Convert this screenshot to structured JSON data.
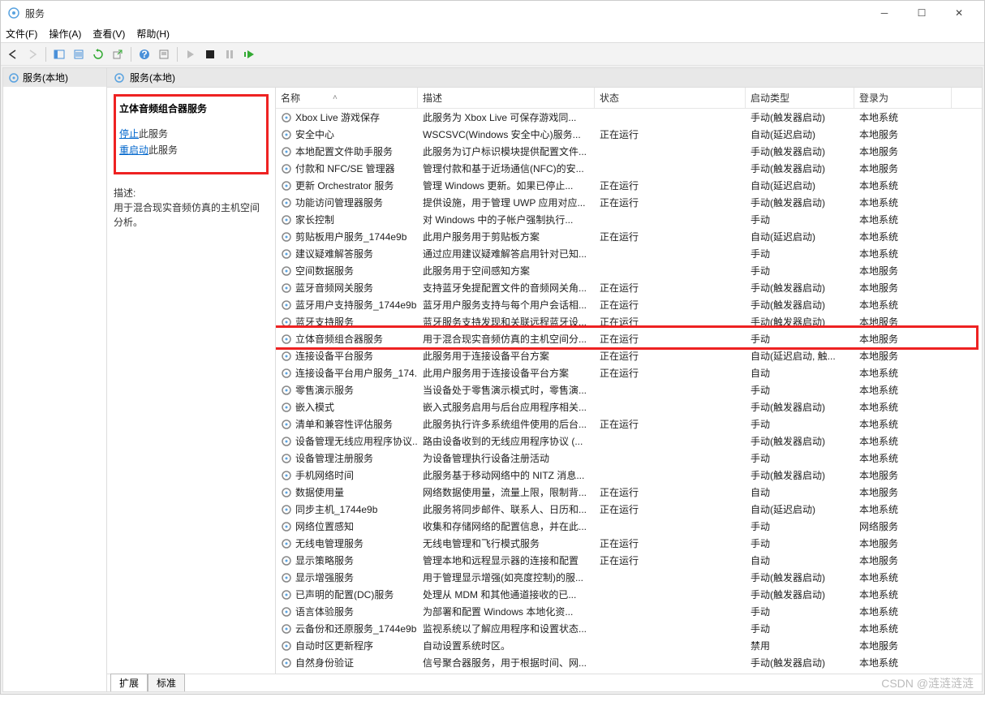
{
  "window": {
    "title": "服务"
  },
  "menu": {
    "file": "文件(F)",
    "action": "操作(A)",
    "view": "查看(V)",
    "help": "帮助(H)"
  },
  "left_tree": {
    "root": "服务(本地)"
  },
  "right_header": {
    "title": "服务(本地)"
  },
  "detail": {
    "service_name": "立体音频组合器服务",
    "stop_link": "停止",
    "stop_suffix": "此服务",
    "restart_link": "重启动",
    "restart_suffix": "此服务",
    "desc_label": "描述:",
    "desc_text": "用于混合现实音频仿真的主机空间分析。"
  },
  "columns": {
    "name": "名称",
    "desc": "描述",
    "status": "状态",
    "start": "启动类型",
    "logon": "登录为"
  },
  "tabs": {
    "ext": "扩展",
    "std": "标准"
  },
  "watermark": "CSDN @涟涟涟涟",
  "services": [
    {
      "name": "Xbox Live 游戏保存",
      "desc": "此服务为 Xbox Live 可保存游戏同...",
      "status": "",
      "start": "手动(触发器启动)",
      "logon": "本地系统"
    },
    {
      "name": "安全中心",
      "desc": "WSCSVC(Windows 安全中心)服务...",
      "status": "正在运行",
      "start": "自动(延迟启动)",
      "logon": "本地服务"
    },
    {
      "name": "本地配置文件助手服务",
      "desc": "此服务为订户标识模块提供配置文件...",
      "status": "",
      "start": "手动(触发器启动)",
      "logon": "本地服务"
    },
    {
      "name": "付款和 NFC/SE 管理器",
      "desc": "管理付款和基于近场通信(NFC)的安...",
      "status": "",
      "start": "手动(触发器启动)",
      "logon": "本地服务"
    },
    {
      "name": "更新 Orchestrator 服务",
      "desc": "管理 Windows 更新。如果已停止...",
      "status": "正在运行",
      "start": "自动(延迟启动)",
      "logon": "本地系统"
    },
    {
      "name": "功能访问管理器服务",
      "desc": "提供设施，用于管理 UWP 应用对应...",
      "status": "正在运行",
      "start": "手动(触发器启动)",
      "logon": "本地系统"
    },
    {
      "name": "家长控制",
      "desc": "对 Windows 中的子帐户强制执行...",
      "status": "",
      "start": "手动",
      "logon": "本地系统"
    },
    {
      "name": "剪贴板用户服务_1744e9b",
      "desc": "此用户服务用于剪贴板方案",
      "status": "正在运行",
      "start": "自动(延迟启动)",
      "logon": "本地系统"
    },
    {
      "name": "建议疑难解答服务",
      "desc": "通过应用建议疑难解答启用针对已知...",
      "status": "",
      "start": "手动",
      "logon": "本地系统"
    },
    {
      "name": "空间数据服务",
      "desc": "此服务用于空间感知方案",
      "status": "",
      "start": "手动",
      "logon": "本地服务"
    },
    {
      "name": "蓝牙音频网关服务",
      "desc": "支持蓝牙免提配置文件的音频网关角...",
      "status": "正在运行",
      "start": "手动(触发器启动)",
      "logon": "本地服务"
    },
    {
      "name": "蓝牙用户支持服务_1744e9b",
      "desc": "蓝牙用户服务支持与每个用户会话相...",
      "status": "正在运行",
      "start": "手动(触发器启动)",
      "logon": "本地系统"
    },
    {
      "name": "蓝牙支持服务",
      "desc": "蓝牙服务支持发现和关联远程蓝牙设...",
      "status": "正在运行",
      "start": "手动(触发器启动)",
      "logon": "本地服务"
    },
    {
      "name": "立体音频组合器服务",
      "desc": "用于混合现实音频仿真的主机空间分...",
      "status": "正在运行",
      "start": "手动",
      "logon": "本地服务",
      "selected": true
    },
    {
      "name": "连接设备平台服务",
      "desc": "此服务用于连接设备平台方案",
      "status": "正在运行",
      "start": "自动(延迟启动, 触...",
      "logon": "本地服务"
    },
    {
      "name": "连接设备平台用户服务_174...",
      "desc": "此用户服务用于连接设备平台方案",
      "status": "正在运行",
      "start": "自动",
      "logon": "本地系统"
    },
    {
      "name": "零售演示服务",
      "desc": "当设备处于零售演示模式时，零售演...",
      "status": "",
      "start": "手动",
      "logon": "本地系统"
    },
    {
      "name": "嵌入模式",
      "desc": "嵌入式服务启用与后台应用程序相关...",
      "status": "",
      "start": "手动(触发器启动)",
      "logon": "本地系统"
    },
    {
      "name": "清单和兼容性评估服务",
      "desc": "此服务执行许多系统组件使用的后台...",
      "status": "正在运行",
      "start": "手动",
      "logon": "本地系统"
    },
    {
      "name": "设备管理无线应用程序协议...",
      "desc": "路由设备收到的无线应用程序协议 (...",
      "status": "",
      "start": "手动(触发器启动)",
      "logon": "本地系统"
    },
    {
      "name": "设备管理注册服务",
      "desc": "为设备管理执行设备注册活动",
      "status": "",
      "start": "手动",
      "logon": "本地系统"
    },
    {
      "name": "手机网络时间",
      "desc": "此服务基于移动网络中的 NITZ 消息...",
      "status": "",
      "start": "手动(触发器启动)",
      "logon": "本地服务"
    },
    {
      "name": "数据使用量",
      "desc": "网络数据使用量，流量上限，限制背...",
      "status": "正在运行",
      "start": "自动",
      "logon": "本地服务"
    },
    {
      "name": "同步主机_1744e9b",
      "desc": "此服务将同步邮件、联系人、日历和...",
      "status": "正在运行",
      "start": "自动(延迟启动)",
      "logon": "本地系统"
    },
    {
      "name": "网络位置感知",
      "desc": "收集和存储网络的配置信息，并在此...",
      "status": "",
      "start": "手动",
      "logon": "网络服务"
    },
    {
      "name": "无线电管理服务",
      "desc": "无线电管理和飞行模式服务",
      "status": "正在运行",
      "start": "手动",
      "logon": "本地服务"
    },
    {
      "name": "显示策略服务",
      "desc": "管理本地和远程显示器的连接和配置",
      "status": "正在运行",
      "start": "自动",
      "logon": "本地服务"
    },
    {
      "name": "显示增强服务",
      "desc": "用于管理显示增强(如亮度控制)的服...",
      "status": "",
      "start": "手动(触发器启动)",
      "logon": "本地系统"
    },
    {
      "name": "已声明的配置(DC)服务",
      "desc": "处理从 MDM 和其他通道接收的已...",
      "status": "",
      "start": "手动(触发器启动)",
      "logon": "本地系统"
    },
    {
      "name": "语言体验服务",
      "desc": "为部署和配置 Windows 本地化资...",
      "status": "",
      "start": "手动",
      "logon": "本地系统"
    },
    {
      "name": "云备份和还原服务_1744e9b",
      "desc": "监视系统以了解应用程序和设置状态...",
      "status": "",
      "start": "手动",
      "logon": "本地系统"
    },
    {
      "name": "自动时区更新程序",
      "desc": "自动设置系统时区。",
      "status": "",
      "start": "禁用",
      "logon": "本地服务"
    },
    {
      "name": "自然身份验证",
      "desc": "信号聚合器服务，用于根据时间、网...",
      "status": "",
      "start": "手动(触发器启动)",
      "logon": "本地系统"
    }
  ]
}
